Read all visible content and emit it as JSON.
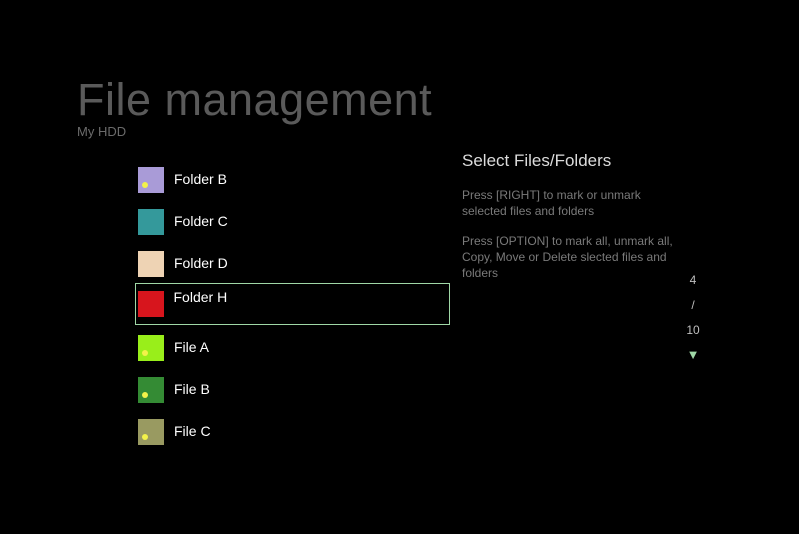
{
  "header": {
    "title": "File management",
    "subtitle": "My HDD"
  },
  "files": [
    {
      "label": "Folder B",
      "color": "#a99bd7",
      "marked_dot": true,
      "selected": false
    },
    {
      "label": "Folder C",
      "color": "#34999b",
      "marked_dot": false,
      "selected": false
    },
    {
      "label": "Folder D",
      "color": "#eed3b4",
      "marked_dot": false,
      "selected": false
    },
    {
      "label": "Folder H",
      "color": "#d7151d",
      "marked_dot": false,
      "selected": true
    },
    {
      "label": "File A",
      "color": "#99ee1a",
      "marked_dot": true,
      "selected": false
    },
    {
      "label": "File B",
      "color": "#348b34",
      "marked_dot": true,
      "selected": false
    },
    {
      "label": "File C",
      "color": "#999a61",
      "marked_dot": true,
      "selected": false
    }
  ],
  "info": {
    "title": "Select Files/Folders",
    "paragraph_1": "Press [RIGHT] to mark or unmark selected files and folders",
    "paragraph_2": "Press [OPTION] to mark all, unmark all, Copy, Move or Delete slected files and folders"
  },
  "pager": {
    "current": "4",
    "separator": "/",
    "total": "10",
    "arrow_icon": "down-arrow-icon"
  },
  "colors": {
    "background": "#000000",
    "selection_border": "#9fd7a6",
    "mark_dot": "#f2f24a"
  }
}
